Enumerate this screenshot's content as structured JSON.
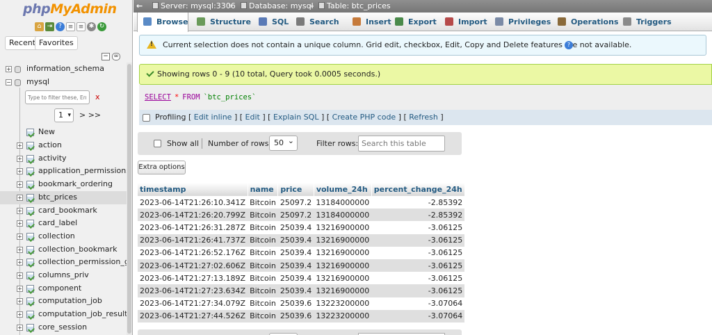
{
  "app": {
    "logo_php": "php",
    "logo_rest": "MyAdmin"
  },
  "nav": {
    "recent_label": "Recent",
    "favorites_label": "Favorites",
    "filter_placeholder": "Type to filter these, Enter",
    "clear_label": "x",
    "page_select_value": "1",
    "next_label": "> >>",
    "new_label": "New",
    "databases": [
      {
        "name": "information_schema"
      },
      {
        "name": "mysql"
      }
    ],
    "tables": [
      {
        "name": "action"
      },
      {
        "name": "activity"
      },
      {
        "name": "application_permissions_re"
      },
      {
        "name": "bookmark_ordering"
      },
      {
        "name": "btc_prices",
        "active": true
      },
      {
        "name": "card_bookmark"
      },
      {
        "name": "card_label"
      },
      {
        "name": "collection"
      },
      {
        "name": "collection_bookmark"
      },
      {
        "name": "collection_permission_grap"
      },
      {
        "name": "columns_priv"
      },
      {
        "name": "component"
      },
      {
        "name": "computation_job"
      },
      {
        "name": "computation_job_result"
      },
      {
        "name": "core_session"
      }
    ]
  },
  "breadcrumb": {
    "back": "←",
    "server": "Server: mysql:3306",
    "sep1": "»",
    "database": "Database: mysql",
    "sep2": "»",
    "table": "Table: btc_prices"
  },
  "tabs": [
    {
      "label": "Browse",
      "icon": "browse-icon",
      "color": "#5a8ac6"
    },
    {
      "label": "Structure",
      "icon": "structure-icon",
      "color": "#6a9a5a"
    },
    {
      "label": "SQL",
      "icon": "sql-icon",
      "color": "#5a7ab6"
    },
    {
      "label": "Search",
      "icon": "search-icon",
      "color": "#7a7a7a"
    },
    {
      "label": "Insert",
      "icon": "insert-icon",
      "color": "#c67a3a"
    },
    {
      "label": "Export",
      "icon": "export-icon",
      "color": "#4a8a4a"
    },
    {
      "label": "Import",
      "icon": "import-icon",
      "color": "#b64a4a"
    },
    {
      "label": "Privileges",
      "icon": "privileges-icon",
      "color": "#7a8aa6"
    },
    {
      "label": "Operations",
      "icon": "operations-icon",
      "color": "#8a6a3a"
    },
    {
      "label": "Triggers",
      "icon": "triggers-icon",
      "color": "#8a8a8a"
    }
  ],
  "notice": {
    "text": "Current selection does not contain a unique column. Grid edit, checkbox, Edit, Copy and Delete features are not available.",
    "help": "?"
  },
  "success": {
    "text": "Showing rows 0 - 9 (10 total, Query took 0.0005 seconds.)"
  },
  "sql": {
    "select": "SELECT",
    "star": "*",
    "from": "FROM",
    "table": "`btc_prices`"
  },
  "profiling": {
    "label": "Profiling",
    "open": "[",
    "edit_inline": "Edit inline",
    "sep1": "] [",
    "edit": "Edit",
    "sep2": "] [",
    "explain": "Explain SQL",
    "sep3": "] [",
    "php": "Create PHP code",
    "sep4": "] [",
    "refresh": "Refresh",
    "close": "]"
  },
  "navigation": {
    "show_all": "Show all",
    "rows_label": "Number of rows:",
    "rows_value": "50",
    "filter_label": "Filter rows:",
    "search_placeholder": "Search this table"
  },
  "extra_options": "Extra options",
  "table": {
    "columns": [
      "timestamp",
      "name",
      "price",
      "volume_24h",
      "percent_change_24h"
    ],
    "rows": [
      [
        "2023-06-14T21:26:10.341Z",
        "Bitcoin",
        "25097.2",
        "13184000000",
        "-2.85392"
      ],
      [
        "2023-06-14T21:26:20.799Z",
        "Bitcoin",
        "25097.2",
        "13184000000",
        "-2.85392"
      ],
      [
        "2023-06-14T21:26:31.287Z",
        "Bitcoin",
        "25039.4",
        "13216900000",
        "-3.06125"
      ],
      [
        "2023-06-14T21:26:41.737Z",
        "Bitcoin",
        "25039.4",
        "13216900000",
        "-3.06125"
      ],
      [
        "2023-06-14T21:26:52.176Z",
        "Bitcoin",
        "25039.4",
        "13216900000",
        "-3.06125"
      ],
      [
        "2023-06-14T21:27:02.606Z",
        "Bitcoin",
        "25039.4",
        "13216900000",
        "-3.06125"
      ],
      [
        "2023-06-14T21:27:13.189Z",
        "Bitcoin",
        "25039.4",
        "13216900000",
        "-3.06125"
      ],
      [
        "2023-06-14T21:27:23.634Z",
        "Bitcoin",
        "25039.4",
        "13216900000",
        "-3.06125"
      ],
      [
        "2023-06-14T21:27:34.079Z",
        "Bitcoin",
        "25039.6",
        "13223200000",
        "-3.07064"
      ],
      [
        "2023-06-14T21:27:44.526Z",
        "Bitcoin",
        "25039.6",
        "13223200000",
        "-3.07064"
      ]
    ]
  }
}
